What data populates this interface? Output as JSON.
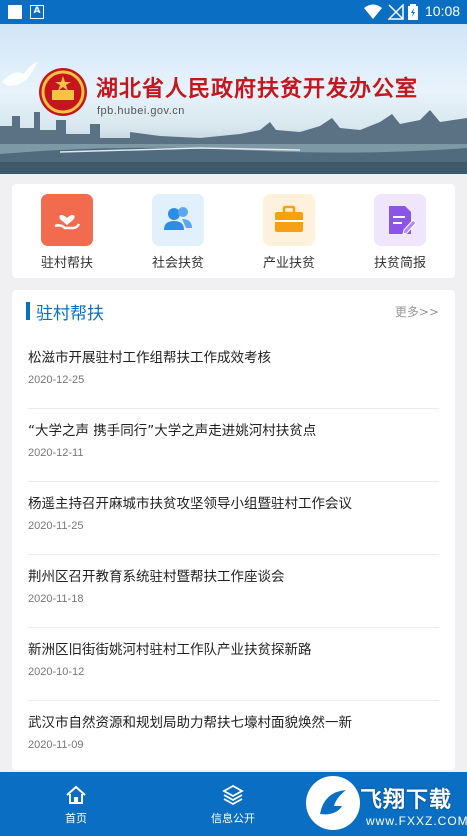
{
  "status_bar": {
    "time": "10:08"
  },
  "banner": {
    "title": "湖北省人民政府扶贫开发办公室",
    "url": "fpb.hubei.gov.cn"
  },
  "quick_links": [
    {
      "label": "驻村帮扶",
      "icon": "hand-heart-icon",
      "color": "#f26b4f"
    },
    {
      "label": "社会扶贫",
      "icon": "people-icon",
      "color": "#2b8ee6"
    },
    {
      "label": "产业扶贫",
      "icon": "briefcase-icon",
      "color": "#f5a113"
    },
    {
      "label": "扶贫简报",
      "icon": "document-edit-icon",
      "color": "#8a55e6"
    }
  ],
  "news": {
    "section_title": "驻村帮扶",
    "more_label": "更多>>",
    "items": [
      {
        "title": "松滋市开展驻村工作组帮扶工作成效考核",
        "date": "2020-12-25"
      },
      {
        "title": "“大学之声 携手同行”大学之声走进姚河村扶贫点",
        "date": "2020-12-11"
      },
      {
        "title": "杨遥主持召开麻城市扶贫攻坚领导小组暨驻村工作会议",
        "date": "2020-11-25"
      },
      {
        "title": "荆州区召开教育系统驻村暨帮扶工作座谈会",
        "date": "2020-11-18"
      },
      {
        "title": "新洲区旧街街姚河村驻村工作队产业扶贫探新路",
        "date": "2020-10-12"
      },
      {
        "title": "武汉市自然资源和规划局助力帮扶七壕村面貌焕然一新",
        "date": "2020-11-09"
      }
    ]
  },
  "bottom_nav": [
    {
      "label": "首页",
      "icon": "home-icon"
    },
    {
      "label": "信息公开",
      "icon": "layers-icon"
    }
  ],
  "watermark": {
    "text": "飞翔下载",
    "sub": "www.FXXZ.COM"
  },
  "colors": {
    "primary": "#0a6fc2",
    "emblem_red": "#c4161c"
  }
}
